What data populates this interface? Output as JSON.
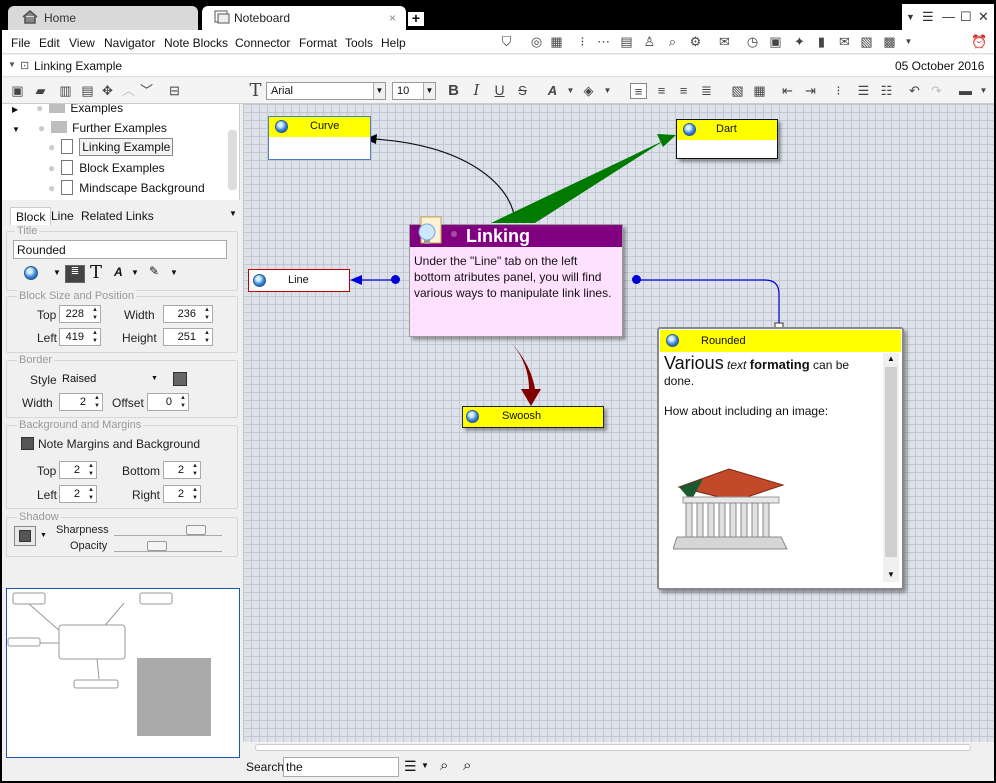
{
  "tabs": [
    {
      "label": "Home"
    },
    {
      "label": "Noteboard",
      "close": "×"
    }
  ],
  "menu": [
    "File",
    "Edit",
    "View",
    "Navigator",
    "Note Blocks",
    "Connector",
    "Format",
    "Tools",
    "Help"
  ],
  "breadcrumb": {
    "title": "Linking Example",
    "date": "05 October 2016"
  },
  "format_toolbar": {
    "font": "Arial",
    "size": "10"
  },
  "tree": [
    {
      "label": "Examples",
      "type": "folder"
    },
    {
      "label": "Further Examples",
      "type": "folder"
    },
    {
      "label": "Linking Example",
      "type": "page"
    },
    {
      "label": "Block Examples",
      "type": "page"
    },
    {
      "label": "Mindscape Background",
      "type": "page"
    }
  ],
  "panel_tabs": [
    "Block",
    "Line",
    "Related Links"
  ],
  "title_section": {
    "heading": "Title",
    "value": "Rounded"
  },
  "size_section": {
    "heading": "Block Size and Position",
    "top_label": "Top",
    "top": "228",
    "width_label": "Width",
    "width": "236",
    "left_label": "Left",
    "left": "419",
    "height_label": "Height",
    "height": "251"
  },
  "border_section": {
    "heading": "Border",
    "style_label": "Style",
    "style": "Raised",
    "width_label": "Width",
    "width": "2",
    "offset_label": "Offset",
    "offset": "0"
  },
  "background_section": {
    "heading": "Background and Margins",
    "note_margins": "Note Margins and Background",
    "top_label": "Top",
    "top": "2",
    "bottom_label": "Bottom",
    "bottom": "2",
    "left_label": "Left",
    "left": "2",
    "right_label": "Right",
    "right": "2"
  },
  "shadow_section": {
    "heading": "Shadow",
    "sharpness_label": "Sharpness",
    "sharpness": 0.82,
    "opacity_label": "Opacity",
    "opacity": 0.38
  },
  "blocks": {
    "curve": "Curve",
    "dart": "Dart",
    "line": "Line",
    "swoosh": "Swoosh",
    "linking": {
      "title": "Linking",
      "body": "Under the \"Line\" tab on the left bottom atributes panel, you will find various ways to manipulate link lines."
    },
    "rounded": {
      "title": "Rounded",
      "w1": "Various",
      "w2": "text",
      "w3": "formating",
      "w4": "can be done.",
      "line2": "How about including an image:"
    }
  },
  "search": {
    "label": "Search",
    "value": "the"
  },
  "colors": {
    "header_yellow": "#ffff00",
    "linking_header": "#800080",
    "linking_body": "#ffe0ff",
    "dart_arrow": "#008000",
    "swoosh_arrow": "#800000",
    "connector_blue": "#0000d8"
  }
}
